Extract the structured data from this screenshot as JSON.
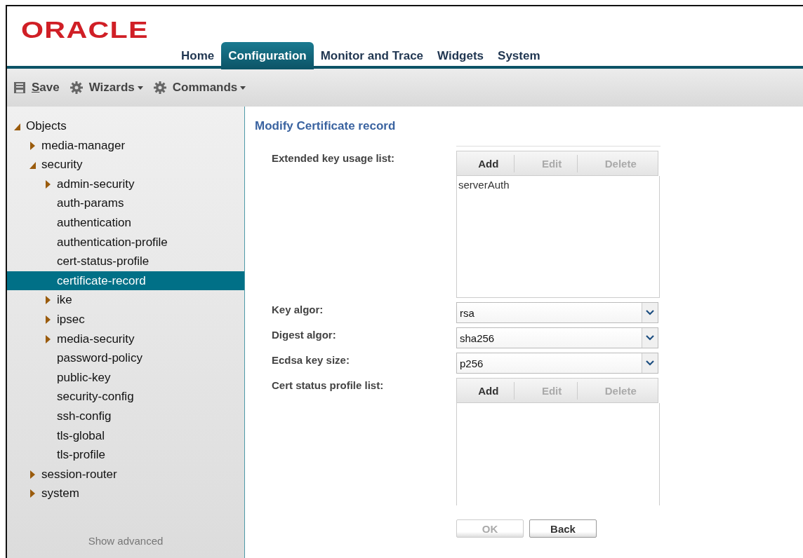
{
  "logo": "ORACLE",
  "tabs": [
    {
      "label": "Home",
      "selected": false
    },
    {
      "label": "Configuration",
      "selected": true
    },
    {
      "label": "Monitor and Trace",
      "selected": false
    },
    {
      "label": "Widgets",
      "selected": false
    },
    {
      "label": "System",
      "selected": false
    }
  ],
  "toolbar": [
    {
      "label": "Save",
      "kind": "save",
      "mnemonic": true,
      "menu": false
    },
    {
      "label": "Wizards",
      "kind": "gear",
      "mnemonic": false,
      "menu": true
    },
    {
      "label": "Commands",
      "kind": "gear",
      "mnemonic": false,
      "menu": true
    }
  ],
  "tree": [
    {
      "label": "Objects",
      "expanded": true,
      "selected": false,
      "children": [
        {
          "label": "media-manager",
          "expanded": false,
          "selected": false
        },
        {
          "label": "security",
          "expanded": true,
          "selected": false,
          "children": [
            {
              "label": "admin-security",
              "expanded": false,
              "selected": false
            },
            {
              "label": "auth-params",
              "selected": false
            },
            {
              "label": "authentication",
              "selected": false
            },
            {
              "label": "authentication-profile",
              "selected": false
            },
            {
              "label": "cert-status-profile",
              "selected": false
            },
            {
              "label": "certificate-record",
              "selected": true
            },
            {
              "label": "ike",
              "expanded": false,
              "selected": false
            },
            {
              "label": "ipsec",
              "expanded": false,
              "selected": false
            },
            {
              "label": "media-security",
              "expanded": false,
              "selected": false
            },
            {
              "label": "password-policy",
              "selected": false
            },
            {
              "label": "public-key",
              "selected": false
            },
            {
              "label": "security-config",
              "selected": false
            },
            {
              "label": "ssh-config",
              "selected": false
            },
            {
              "label": "tls-global",
              "selected": false
            },
            {
              "label": "tls-profile",
              "selected": false
            }
          ]
        },
        {
          "label": "session-router",
          "expanded": false,
          "selected": false
        },
        {
          "label": "system",
          "expanded": false,
          "selected": false
        }
      ]
    }
  ],
  "show_advanced": "Show advanced",
  "form": {
    "title": "Modify Certificate record",
    "fields": [
      {
        "kind": "list",
        "label": "Extended key usage list:",
        "buttons": [
          {
            "label": "Add",
            "disabled": false
          },
          {
            "label": "Edit",
            "disabled": true
          },
          {
            "label": "Delete",
            "disabled": true
          }
        ],
        "items": [
          "serverAuth"
        ]
      },
      {
        "kind": "select",
        "label": "Key algor:",
        "value": "rsa"
      },
      {
        "kind": "select",
        "label": "Digest algor:",
        "value": "sha256"
      },
      {
        "kind": "select",
        "label": "Ecdsa key size:",
        "value": "p256"
      },
      {
        "kind": "list",
        "label": "Cert status profile list:",
        "buttons": [
          {
            "label": "Add",
            "disabled": false
          },
          {
            "label": "Edit",
            "disabled": true
          },
          {
            "label": "Delete",
            "disabled": true
          }
        ]
      }
    ],
    "buttons": [
      {
        "label": "OK",
        "disabled": true
      },
      {
        "label": "Back",
        "disabled": false
      }
    ]
  }
}
